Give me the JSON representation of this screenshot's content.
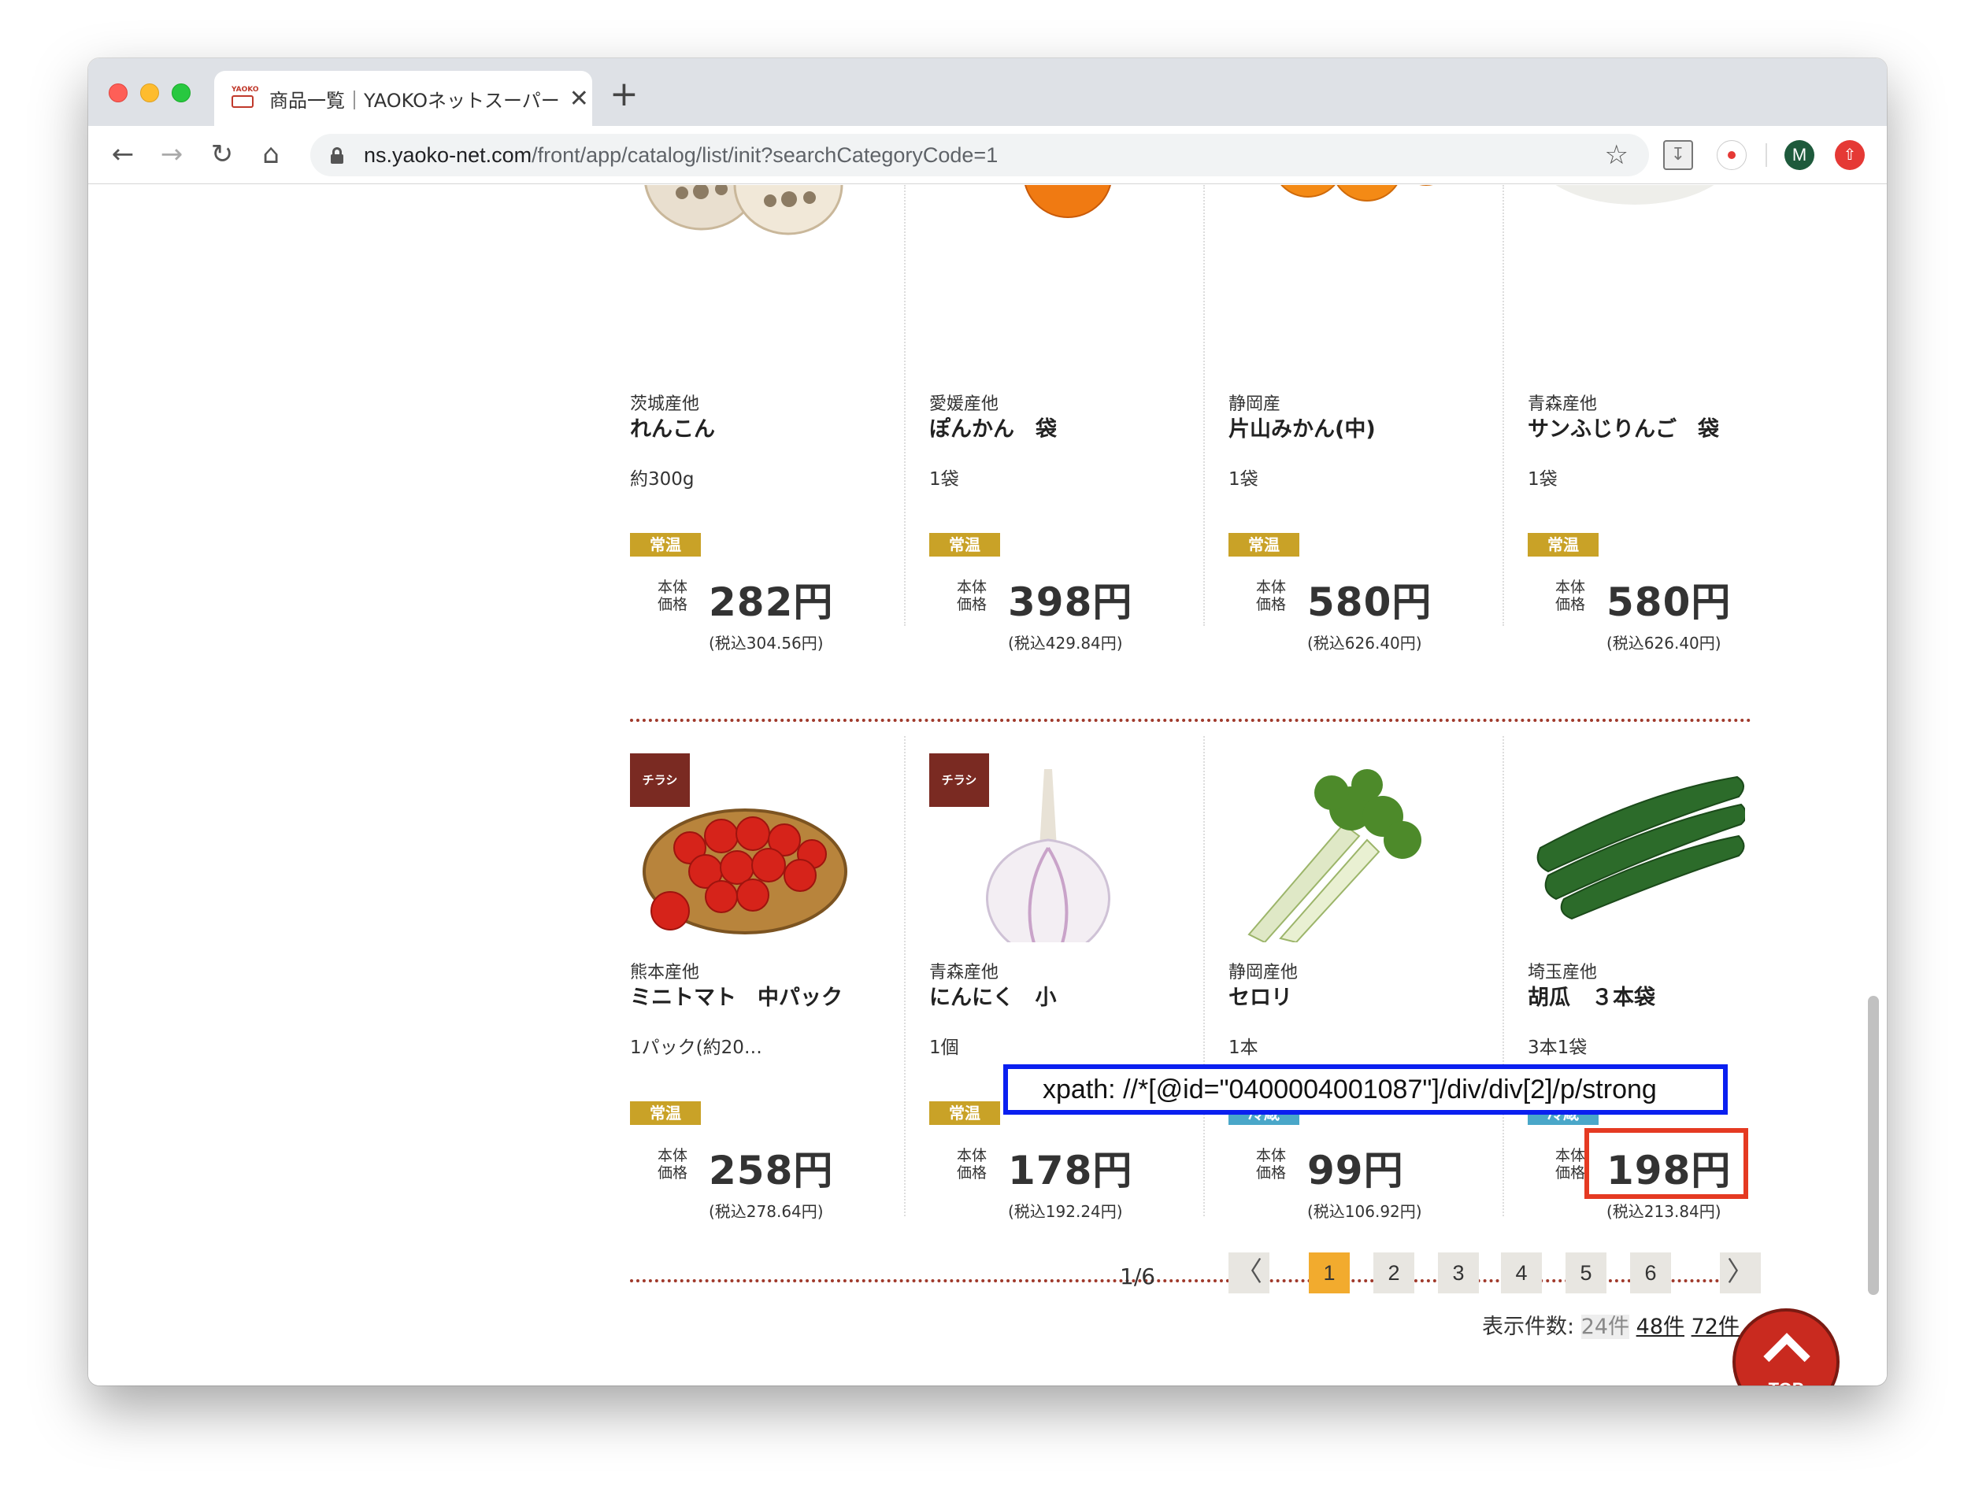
{
  "browser": {
    "tab_title": "商品一覧｜YAOKOネットスーパー",
    "tab_close": "✕",
    "new_tab": "+",
    "url_host": "ns.yaoko-net.com",
    "url_path": "/front/app/catalog/list/init?searchCategoryCode=1",
    "favicon_text": "YAOKO",
    "profile_initial": "M"
  },
  "products": [
    {
      "origin": "茨城産他",
      "name": "れんこん",
      "qty": "約300g",
      "temp": "常温",
      "honti": "本体価格",
      "price": "282円",
      "tax": "(税込304.56円)",
      "image": "lotus-root",
      "chirashi": ""
    },
    {
      "origin": "愛媛産他",
      "name": "ぽんかん　袋",
      "qty": "1袋",
      "temp": "常温",
      "honti": "本体価格",
      "price": "398円",
      "tax": "(税込429.84円)",
      "image": "ponkan",
      "chirashi": ""
    },
    {
      "origin": "静岡産",
      "name": "片山みかん(中)",
      "qty": "1袋",
      "temp": "常温",
      "honti": "本体価格",
      "price": "580円",
      "tax": "(税込626.40円)",
      "image": "mikan",
      "chirashi": ""
    },
    {
      "origin": "青森産他",
      "name": "サンふじりんご　袋",
      "qty": "1袋",
      "temp": "常温",
      "honti": "本体価格",
      "price": "580円",
      "tax": "(税込626.40円)",
      "image": "apple",
      "chirashi": ""
    },
    {
      "origin": "熊本産他",
      "name": "ミニトマト　中パック",
      "qty": "1パック(約20…",
      "temp": "常温",
      "honti": "本体価格",
      "price": "258円",
      "tax": "(税込278.64円)",
      "image": "tomato",
      "chirashi": "チラシ"
    },
    {
      "origin": "青森産他",
      "name": "にんにく　小",
      "qty": "1個",
      "temp": "常温",
      "honti": "本体価格",
      "price": "178円",
      "tax": "(税込192.24円)",
      "image": "garlic",
      "chirashi": "チラシ"
    },
    {
      "origin": "静岡産他",
      "name": "セロリ",
      "qty": "1本",
      "temp": "冷蔵",
      "honti": "本体価格",
      "price": "99円",
      "tax": "(税込106.92円)",
      "image": "celery",
      "chirashi": ""
    },
    {
      "origin": "埼玉産他",
      "name": "胡瓜　３本袋",
      "qty": "3本1袋",
      "temp": "冷蔵",
      "honti": "本体価格",
      "price": "198円",
      "tax": "(税込213.84円)",
      "image": "cucumber",
      "chirashi": ""
    }
  ],
  "pager": {
    "count": "1/6",
    "prev": "〈",
    "next": "〉",
    "pages": [
      "1",
      "2",
      "3",
      "4",
      "5",
      "6"
    ],
    "active": "1",
    "display_label": "表示件数:",
    "display_options": [
      "24件",
      "48件",
      "72件"
    ]
  },
  "top_button": "TOP",
  "annotation": {
    "xpath": "xpath: //*[@id=\"0400004001087\"]/div/div[2]/p/strong"
  },
  "colors": {
    "badge_normal": "#c9a227",
    "badge_cold": "#4aa7c9",
    "chirashi": "#7a2a22",
    "divider": "#a0392b",
    "active_page": "#f2ab2e",
    "xpath_border": "#0a1ff0",
    "highlight_border": "#e53a22",
    "top_button": "#c92a1f"
  }
}
